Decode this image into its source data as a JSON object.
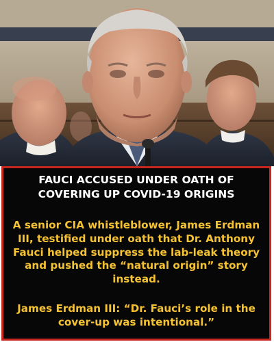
{
  "headline": {
    "line1": "FAUCI ACCUSED UNDER OATH OF",
    "line2": "COVERING UP COVID-19 ORIGINS"
  },
  "body": {
    "line1": "A senior CIA whistleblower, James Erdman",
    "line2": "III, testified under oath that Dr. Anthony",
    "line3": "Fauci helped suppress the lab-leak theory",
    "line4": "and pushed the “natural origin” story",
    "line5": "instead."
  },
  "quote": {
    "line1": "James Erdman III: “Dr. Fauci’s role in the",
    "line2": "cover-up was intentional.”"
  },
  "colors": {
    "panel_background": "#070707",
    "panel_border": "#c8261f",
    "headline_text": "#ffffff",
    "body_text": "#f5c234"
  }
}
